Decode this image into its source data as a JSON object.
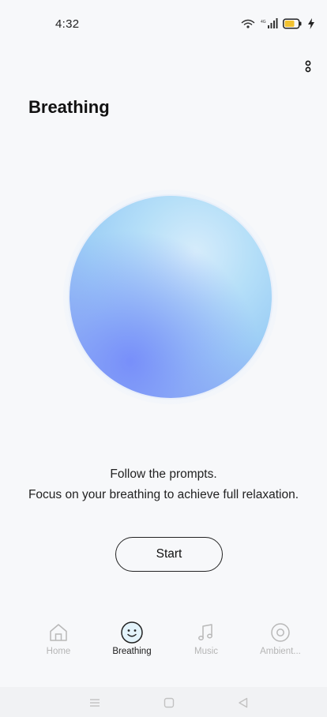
{
  "status_bar": {
    "time": "4:32",
    "icons": [
      "wifi-icon",
      "signal-icon",
      "battery-icon",
      "charging-icon"
    ],
    "battery_color": "#f2c230"
  },
  "header": {
    "title": "Breathing",
    "more_icon": "more-vertical-icon"
  },
  "main": {
    "prompt_line_1": "Follow the prompts.",
    "prompt_line_2": "Focus on your breathing to achieve full relaxation.",
    "start_label": "Start"
  },
  "bottom_nav": {
    "items": [
      {
        "label": "Home",
        "icon": "home-icon",
        "active": false
      },
      {
        "label": "Breathing",
        "icon": "smiley-icon",
        "active": true
      },
      {
        "label": "Music",
        "icon": "music-note-icon",
        "active": false
      },
      {
        "label": "Ambient...",
        "icon": "ambient-icon",
        "active": false
      }
    ],
    "active_color": "#2fa8d8",
    "inactive_color": "#b5b5b5"
  },
  "system_nav": {
    "items": [
      "menu-icon",
      "home-square-icon",
      "back-triangle-icon"
    ]
  }
}
